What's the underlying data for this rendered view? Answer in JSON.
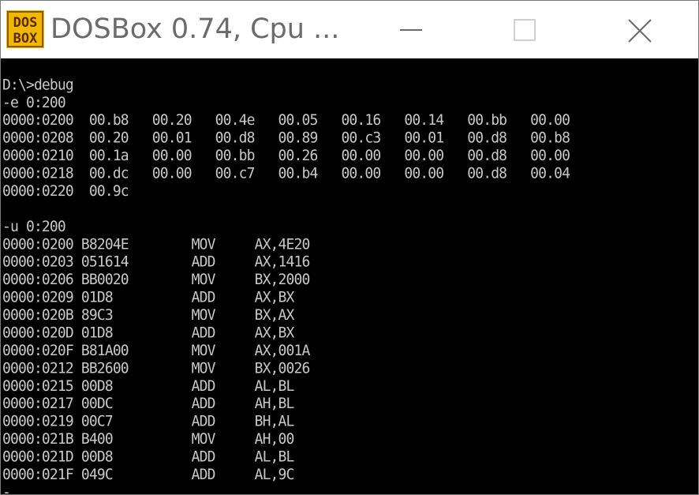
{
  "window": {
    "title": "DOSBox 0.74, Cpu ...",
    "icon": "dosbox-logo-icon",
    "icon_text_top": "DOS",
    "icon_text_bottom": "BOX",
    "controls": {
      "minimize": "minimize-icon",
      "maximize": "maximize-icon",
      "close": "close-icon"
    }
  },
  "colors": {
    "console_bg": "#000000",
    "console_text": "#c8c8c8",
    "titlebar_bg": "#ffffff",
    "title_text": "#6b6b6b",
    "icon_bg": "#f0b800",
    "icon_text": "#5a2a00"
  },
  "console": {
    "lines": [
      "D:\\>debug",
      "-e 0:200",
      "0000:0200  00.b8   00.20   00.4e   00.05   00.16   00.14   00.bb   00.00",
      "0000:0208  00.20   00.01   00.d8   00.89   00.c3   00.01   00.d8   00.b8",
      "0000:0210  00.1a   00.00   00.bb   00.26   00.00   00.00   00.d8   00.00",
      "0000:0218  00.dc   00.00   00.c7   00.b4   00.00   00.00   00.d8   00.04",
      "0000:0220  00.9c",
      "",
      "-u 0:200",
      "0000:0200 B8204E        MOV     AX,4E20",
      "0000:0203 051614        ADD     AX,1416",
      "0000:0206 BB0020        MOV     BX,2000",
      "0000:0209 01D8          ADD     AX,BX",
      "0000:020B 89C3          MOV     BX,AX",
      "0000:020D 01D8          ADD     AX,BX",
      "0000:020F B81A00        MOV     AX,001A",
      "0000:0212 BB2600        MOV     BX,0026",
      "0000:0215 00D8          ADD     AL,BL",
      "0000:0217 00DC          ADD     AH,BL",
      "0000:0219 00C7          ADD     BH,AL",
      "0000:021B B400          MOV     AH,00",
      "0000:021D 00D8          ADD     AL,BL",
      "0000:021F 049C          ADD     AL,9C"
    ],
    "prompt": "-"
  }
}
